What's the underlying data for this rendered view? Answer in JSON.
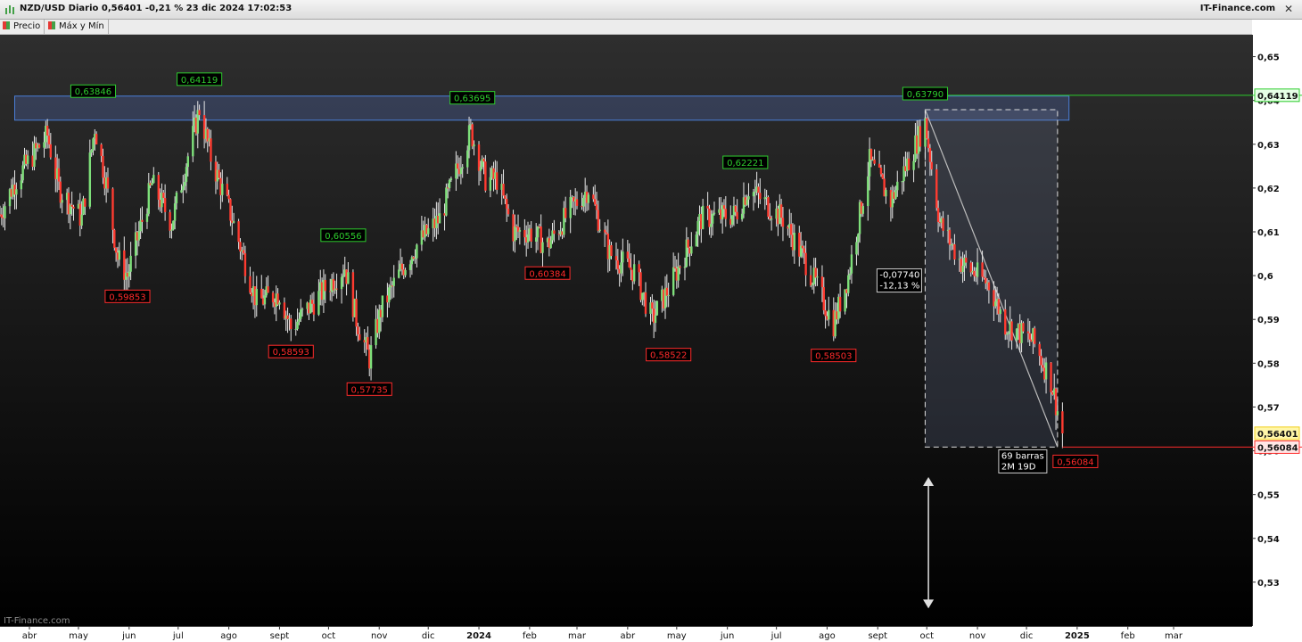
{
  "window": {
    "title": "NZD/USD Diario 0,56401 -0,21 % 23 dic 2024 17:02:53",
    "brand": "IT-Finance.com",
    "close_label": "✕"
  },
  "legend": [
    {
      "label": "Precio"
    },
    {
      "label": "Máx y Mín"
    }
  ],
  "watermark": "IT-Finance.com",
  "colors": {
    "up": "#7ee07a",
    "down": "#ff3b30",
    "wick": "#e8e8e8",
    "high_box": "#4a7fd8",
    "high_label": "#2dcc2d",
    "low_label": "#ff2b2b",
    "last_price": "#f0d020",
    "band": "#3a3f5a"
  },
  "chart_data": {
    "type": "candlestick",
    "symbol": "NZD/USD",
    "period": "Diario",
    "ylim": [
      0.52,
      0.655
    ],
    "y_ticks": [
      "0,53",
      "0,54",
      "0,55",
      "0,56",
      "0,57",
      "0,58",
      "0,59",
      "0,6",
      "0,61",
      "0,62",
      "0,63",
      "0,64",
      "0,65"
    ],
    "x_ticks": [
      "abr",
      "may",
      "jun",
      "jul",
      "ago",
      "sept",
      "oct",
      "nov",
      "dic",
      "2024",
      "feb",
      "mar",
      "abr",
      "may",
      "jun",
      "jul",
      "ago",
      "sept",
      "oct",
      "nov",
      "dic",
      "2025",
      "feb",
      "mar"
    ],
    "bold_x_ticks": [
      "2024",
      "2025"
    ],
    "x_range": [
      "2023-03-14",
      "2025-04-18"
    ],
    "price_path": [
      [
        "2023-03-14",
        0.614
      ],
      [
        "2023-03-24",
        0.622
      ],
      [
        "2023-04-06",
        0.629
      ],
      [
        "2023-04-12",
        0.632
      ],
      [
        "2023-04-19",
        0.62
      ],
      [
        "2023-05-03",
        0.613
      ],
      [
        "2023-05-11",
        0.634
      ],
      [
        "2023-05-18",
        0.621
      ],
      [
        "2023-05-25",
        0.604
      ],
      [
        "2023-05-31",
        0.6
      ],
      [
        "2023-06-15",
        0.621
      ],
      [
        "2023-06-27",
        0.612
      ],
      [
        "2023-07-14",
        0.638
      ],
      [
        "2023-07-21",
        0.627
      ],
      [
        "2023-08-03",
        0.613
      ],
      [
        "2023-08-18",
        0.594
      ],
      [
        "2023-09-01",
        0.596
      ],
      [
        "2023-09-08",
        0.588
      ],
      [
        "2023-09-29",
        0.597
      ],
      [
        "2023-10-11",
        0.602
      ],
      [
        "2023-10-18",
        0.59
      ],
      [
        "2023-10-26",
        0.581
      ],
      [
        "2023-11-02",
        0.592
      ],
      [
        "2023-11-14",
        0.601
      ],
      [
        "2023-11-24",
        0.607
      ],
      [
        "2023-12-08",
        0.613
      ],
      [
        "2023-12-27",
        0.633
      ],
      [
        "2024-01-05",
        0.622
      ],
      [
        "2024-01-12",
        0.622
      ],
      [
        "2024-01-22",
        0.61
      ],
      [
        "2024-02-01",
        0.61
      ],
      [
        "2024-02-12",
        0.607
      ],
      [
        "2024-02-26",
        0.615
      ],
      [
        "2024-03-08",
        0.62
      ],
      [
        "2024-03-21",
        0.605
      ],
      [
        "2024-04-05",
        0.601
      ],
      [
        "2024-04-16",
        0.59
      ],
      [
        "2024-04-26",
        0.597
      ],
      [
        "2024-05-16",
        0.613
      ],
      [
        "2024-06-06",
        0.614
      ],
      [
        "2024-06-14",
        0.62
      ],
      [
        "2024-07-05",
        0.613
      ],
      [
        "2024-07-19",
        0.603
      ],
      [
        "2024-08-05",
        0.589
      ],
      [
        "2024-08-14",
        0.6
      ],
      [
        "2024-08-27",
        0.626
      ],
      [
        "2024-09-09",
        0.617
      ],
      [
        "2024-09-30",
        0.635
      ],
      [
        "2024-10-09",
        0.612
      ],
      [
        "2024-10-22",
        0.603
      ],
      [
        "2024-11-08",
        0.598
      ],
      [
        "2024-11-18",
        0.589
      ],
      [
        "2024-12-05",
        0.585
      ],
      [
        "2024-12-16",
        0.576
      ],
      [
        "2024-12-23",
        0.564
      ]
    ],
    "resistance_zone": {
      "from": "2023-03-23",
      "to": "2024-12-27",
      "low": 0.6355,
      "high": 0.641
    },
    "peaks": [
      {
        "date": "2023-05-10",
        "value": 0.63846,
        "label": "0,63846"
      },
      {
        "date": "2023-07-14",
        "value": 0.64119,
        "label": "0,64119"
      },
      {
        "date": "2023-10-10",
        "value": 0.60556,
        "label": "0,60556"
      },
      {
        "date": "2023-12-28",
        "value": 0.63695,
        "label": "0,63695"
      },
      {
        "date": "2024-06-12",
        "value": 0.62221,
        "label": "0,62221"
      },
      {
        "date": "2024-09-30",
        "value": 0.6379,
        "label": "0,63790"
      }
    ],
    "troughs": [
      {
        "date": "2023-05-31",
        "value": 0.59853,
        "label": "0,59853"
      },
      {
        "date": "2023-09-08",
        "value": 0.58593,
        "label": "0,58593"
      },
      {
        "date": "2023-10-26",
        "value": 0.57735,
        "label": "0,57735"
      },
      {
        "date": "2024-02-12",
        "value": 0.60384,
        "label": "0,60384"
      },
      {
        "date": "2024-04-26",
        "value": 0.58522,
        "label": "0,58522"
      },
      {
        "date": "2024-08-05",
        "value": 0.58503,
        "label": "0,58503"
      },
      {
        "date": "2024-12-20",
        "value": 0.56084,
        "label": "0,56084"
      }
    ],
    "measure": {
      "from": "2024-09-30",
      "to": "2024-12-20",
      "high": 0.6379,
      "low": 0.56084,
      "change": "-0,07740",
      "change_pct": "-12,13 %",
      "bars": "69 barras",
      "duration": "2M 19D",
      "arrow_from": 0.554,
      "arrow_to": 0.524
    },
    "levels": [
      {
        "value": 0.64119,
        "label": "0,64119",
        "kind": "high"
      },
      {
        "value": 0.56401,
        "label": "0,56401",
        "kind": "last"
      },
      {
        "value": 0.56084,
        "label": "0,56084",
        "kind": "low"
      }
    ]
  }
}
